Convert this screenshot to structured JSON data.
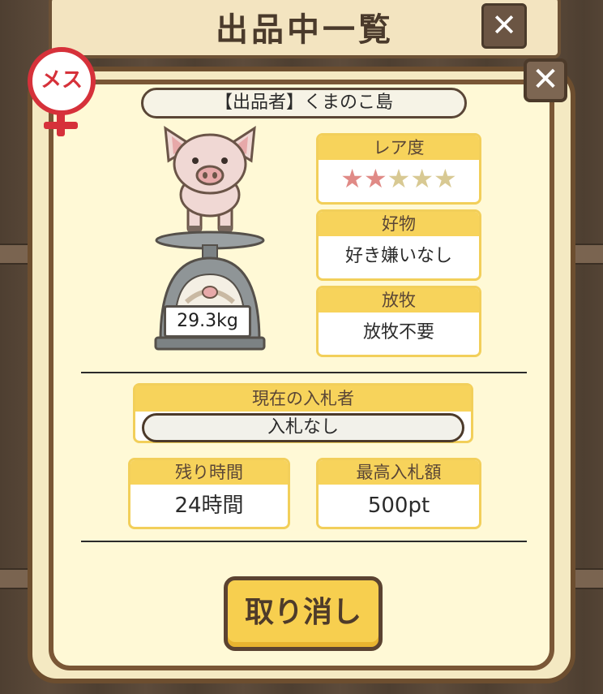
{
  "header": {
    "title": "出品中一覧",
    "close_icon": "close-icon"
  },
  "dialog": {
    "close_icon": "close-icon",
    "gender_badge": "メス",
    "seller": "【出品者】くまのこ島",
    "pig": {
      "weight": "29.3kg"
    },
    "rarity": {
      "label": "レア度",
      "stars_total": 5,
      "stars_filled": 2
    },
    "favorite": {
      "label": "好物",
      "value": "好き嫌いなし"
    },
    "grazing": {
      "label": "放牧",
      "value": "放牧不要"
    },
    "current_bidder": {
      "label": "現在の入札者",
      "value": "入札なし"
    },
    "time_left": {
      "label": "残り時間",
      "value": "24時間"
    },
    "highest_bid": {
      "label": "最高入札額",
      "value": "500pt"
    },
    "cancel_button": "取り消し"
  },
  "colors": {
    "accent": "#f7d35b",
    "frame": "#6d4e2f",
    "panel": "#fff9d6",
    "star_on": "#e08a86",
    "star_off": "#d8c993",
    "female": "#d6313a"
  }
}
